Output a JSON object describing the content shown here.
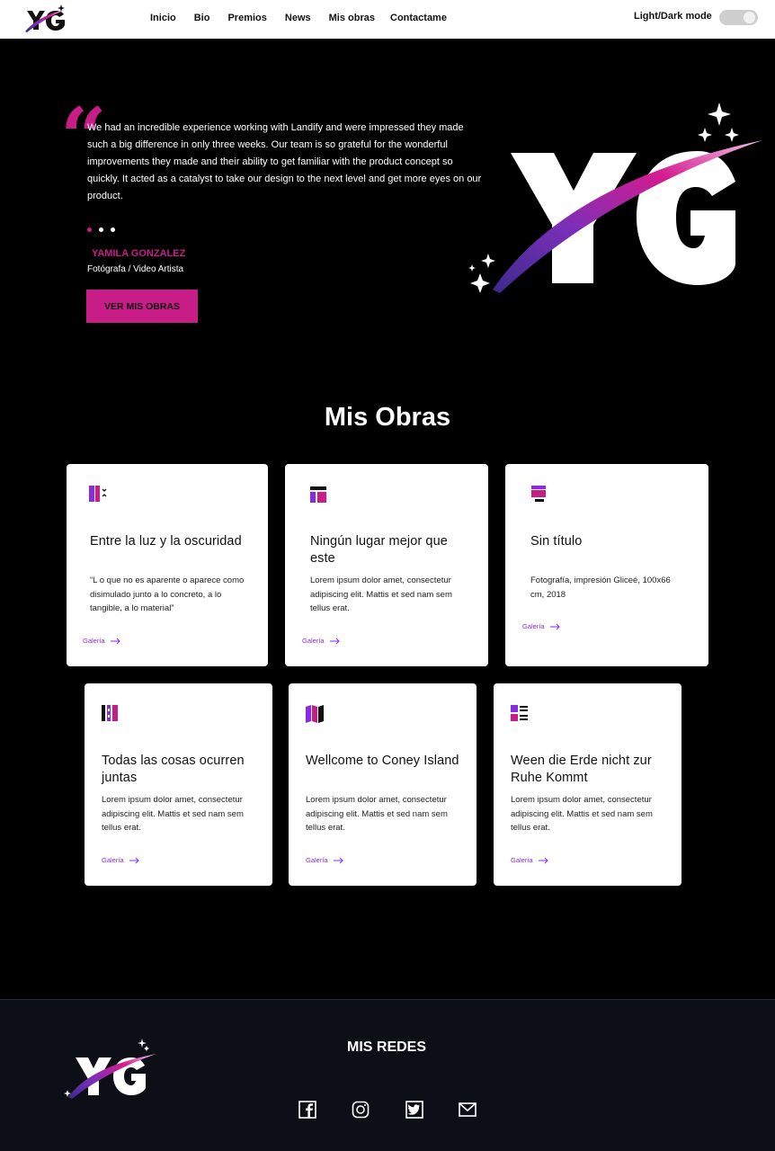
{
  "nav": {
    "links": [
      "Inicio",
      "Bio",
      "Premios",
      "News",
      "Mis obras",
      "Contactame"
    ],
    "mode_label": "Light/Dark mode"
  },
  "hero": {
    "quote": "We had an incredible experience working with Landify and were impressed they made such a big difference in only three weeks. Our team is so grateful for the wonderful improvements they made and their ability to get familiar with the product concept so quickly. It acted as a catalyst to take our design to the next level and get more eyes on our product.",
    "author": "YAMILA GONZALEZ",
    "role": "Fotógrafa / Video Artista",
    "cta": "VER MIS OBRAS"
  },
  "obras": {
    "title": "Mis Obras",
    "cards": [
      {
        "title": "Entre la luz y la oscuridad",
        "desc": "“L o que no es aparente o aparece como disimulado junto a lo concreto, a lo tangible, a lo material”",
        "link": "Galería",
        "icon": "columns-icon"
      },
      {
        "title": "Ningún lugar mejor que este",
        "desc": "Lorem ipsum dolor amet, consectetur adipiscing elit. Mattis et sed nam sem tellus erat.",
        "link": "Galería",
        "icon": "layout-icon"
      },
      {
        "title": "Sin título",
        "desc": "Fotografía, impresión Gliceé, 100x66 cm, 2018",
        "link": "Galería",
        "icon": "window-icon"
      },
      {
        "title": "Todas las cosas ocurren juntas",
        "desc": "Lorem ipsum dolor amet, consectetur adipiscing elit. Mattis et sed nam sem tellus erat.",
        "link": "Galería",
        "icon": "panels-icon"
      },
      {
        "title": "Wellcome to Coney Island",
        "desc": "Lorem ipsum dolor amet, consectetur adipiscing elit. Mattis et sed nam sem tellus erat.",
        "link": "Galería",
        "icon": "map-icon"
      },
      {
        "title": "Ween die Erde nicht zur Ruhe Kommt",
        "desc": "Lorem ipsum dolor amet, consectetur adipiscing elit. Mattis et sed nam sem tellus erat.",
        "link": "Galería",
        "icon": "list-icon"
      }
    ]
  },
  "footer": {
    "title": "MIS REDES",
    "socials": [
      "facebook-icon",
      "instagram-icon",
      "twitter-icon",
      "mail-icon"
    ]
  },
  "colors": {
    "accent": "#c81c86",
    "purple": "#8a2be2",
    "footer_bg": "#0d0f16"
  }
}
